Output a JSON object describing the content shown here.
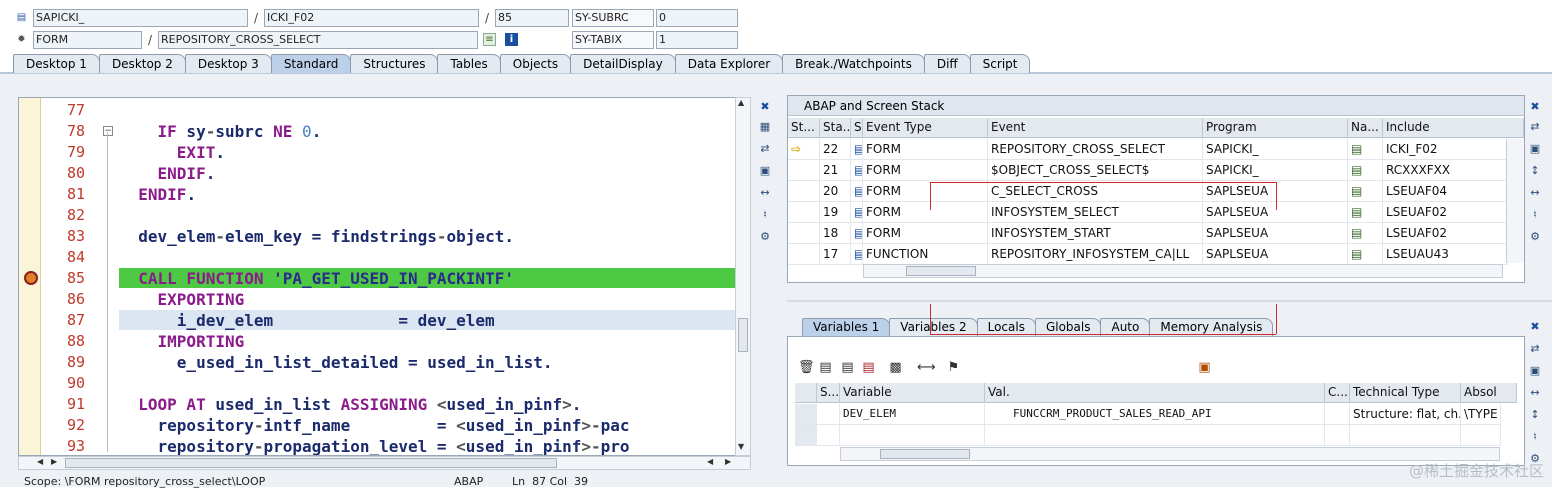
{
  "header": {
    "row1": {
      "program": "SAPICKI_",
      "include": "ICKI_F02",
      "line": "85",
      "sysfield": "SY-SUBRC",
      "sysval": "0"
    },
    "row2": {
      "type": "FORM",
      "name": "REPOSITORY_CROSS_SELECT",
      "sysfield": "SY-TABIX",
      "sysval": "1"
    },
    "separator": "/"
  },
  "tabs": [
    "Desktop 1",
    "Desktop 2",
    "Desktop 3",
    "Standard",
    "Structures",
    "Tables",
    "Objects",
    "DetailDisplay",
    "Data Explorer",
    "Break./Watchpoints",
    "Diff",
    "Script"
  ],
  "active_tab": "Standard",
  "editor": {
    "lines": [
      {
        "n": "77",
        "html": ""
      },
      {
        "n": "78",
        "html": "    <span class='kw'>IF</span> sy<span class='op'>-</span>subrc <span class='kw'>NE</span> <span class='num'>0</span>."
      },
      {
        "n": "79",
        "html": "      <span class='kw'>EXIT</span>."
      },
      {
        "n": "80",
        "html": "    <span class='kw'>ENDIF</span>."
      },
      {
        "n": "81",
        "html": "  <span class='kw'>ENDIF</span>."
      },
      {
        "n": "82",
        "html": ""
      },
      {
        "n": "83",
        "html": "  dev_elem<span class='op'>-</span>elem_key = findstrings<span class='op'>-</span>object."
      },
      {
        "n": "84",
        "html": ""
      },
      {
        "n": "85",
        "html": "  <span class='kw'>CALL FUNCTION</span> <span class='str'>'PA_GET_USED_IN_PACKINTF'</span>"
      },
      {
        "n": "86",
        "html": "    <span class='kw'>EXPORTING</span>"
      },
      {
        "n": "87",
        "html": "      i_dev_elem             = dev_elem"
      },
      {
        "n": "88",
        "html": "    <span class='kw'>IMPORTING</span>"
      },
      {
        "n": "89",
        "html": "      e_used_in_list_detailed = used_in_list."
      },
      {
        "n": "90",
        "html": ""
      },
      {
        "n": "91",
        "html": "  <span class='kw'>LOOP AT</span> used_in_list <span class='kw'>ASSIGNING</span> <span class='op'>&lt;</span>used_in_pinf<span class='op'>&gt;</span>."
      },
      {
        "n": "92",
        "html": "    repository<span class='op'>-</span>intf_name         = <span class='op'>&lt;</span>used_in_pinf<span class='op'>&gt;-</span>pac"
      },
      {
        "n": "93",
        "html": "    repository<span class='op'>-</span>propagation_level = <span class='op'>&lt;</span>used_in_pinf<span class='op'>&gt;-</span>pro"
      }
    ],
    "current_line": "85",
    "cursor_line": "87"
  },
  "status": {
    "scope": "Scope: \\FORM repository_cross_select\\LOOP",
    "lang": "ABAP",
    "pos": "Ln  87 Col  39"
  },
  "stack": {
    "title": "ABAP and Screen Stack",
    "columns": [
      "St...",
      "Sta...",
      "S...",
      "Event Type",
      "Event",
      "Program",
      "Na...",
      "Include"
    ],
    "rows": [
      {
        "level": "22",
        "type": "FORM",
        "event": "REPOSITORY_CROSS_SELECT",
        "program": "SAPICKI_",
        "include": "ICKI_F02",
        "current": true
      },
      {
        "level": "21",
        "type": "FORM",
        "event": "$OBJECT_CROSS_SELECT$",
        "program": "SAPICKI_",
        "include": "RCXXXFXX",
        "current": false
      },
      {
        "level": "20",
        "type": "FORM",
        "event": "C_SELECT_CROSS",
        "program": "SAPLSEUA",
        "include": "LSEUAF04",
        "current": false
      },
      {
        "level": "19",
        "type": "FORM",
        "event": "INFOSYSTEM_SELECT",
        "program": "SAPLSEUA",
        "include": "LSEUAF02",
        "current": false
      },
      {
        "level": "18",
        "type": "FORM",
        "event": "INFOSYSTEM_START",
        "program": "SAPLSEUA",
        "include": "LSEUAF02",
        "current": false
      },
      {
        "level": "17",
        "type": "FUNCTION",
        "event": "REPOSITORY_INFOSYSTEM_CA|LL",
        "program": "SAPLSEUA",
        "include": "LSEUAU43",
        "current": false
      }
    ]
  },
  "var_tabs": [
    "Variables 1",
    "Variables 2",
    "Locals",
    "Globals",
    "Auto",
    "Memory Analysis"
  ],
  "active_var_tab": "Variables 1",
  "vars": {
    "columns": [
      "S...",
      "Variable",
      "Val.",
      "C...",
      "Technical Type",
      "Absolu"
    ],
    "rows": [
      {
        "name": "DEV_ELEM",
        "value": "FUNCCRM_PRODUCT_SALES_READ_API",
        "type": "Structure: flat, ch...",
        "abs": "\\TYPE"
      }
    ]
  },
  "watermark": "@稀土掘金技术社区",
  "colors": {
    "exec_line": "#4ec944",
    "keyword": "#8b1a8b",
    "line_numbers": "#c0392b",
    "annotation": "#cf2b2b"
  }
}
